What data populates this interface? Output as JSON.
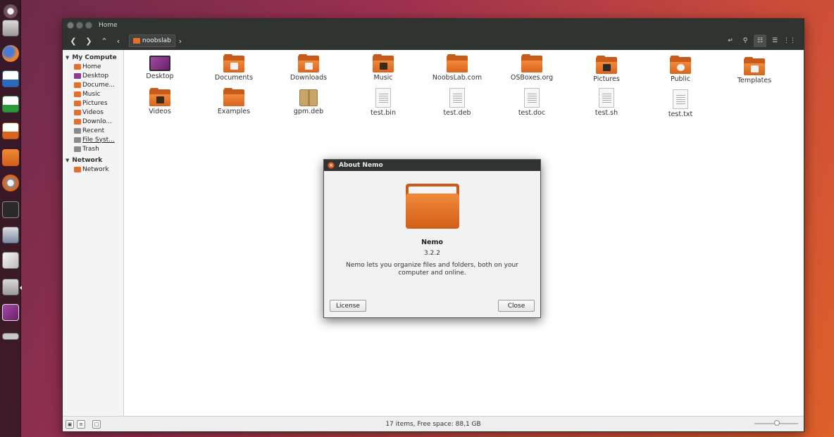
{
  "window": {
    "title": "Home",
    "breadcrumb": "noobslab"
  },
  "sidebar": {
    "sections": [
      {
        "title": "My Compute",
        "items": [
          {
            "label": "Home",
            "icon": "home-folder-icon"
          },
          {
            "label": "Desktop",
            "icon": "desktop-icon"
          },
          {
            "label": "Docume...",
            "icon": "documents-folder-icon"
          },
          {
            "label": "Music",
            "icon": "music-folder-icon"
          },
          {
            "label": "Pictures",
            "icon": "pictures-folder-icon"
          },
          {
            "label": "Videos",
            "icon": "videos-folder-icon"
          },
          {
            "label": "Downlo...",
            "icon": "downloads-folder-icon"
          },
          {
            "label": "Recent",
            "icon": "recent-icon"
          },
          {
            "label": "File Syst...",
            "icon": "drive-icon"
          },
          {
            "label": "Trash",
            "icon": "trash-icon"
          }
        ]
      },
      {
        "title": "Network",
        "items": [
          {
            "label": "Network",
            "icon": "network-icon"
          }
        ]
      }
    ]
  },
  "files": [
    {
      "label": "Desktop",
      "kind": "monitor"
    },
    {
      "label": "Documents",
      "kind": "folder-docs"
    },
    {
      "label": "Downloads",
      "kind": "folder-down"
    },
    {
      "label": "Music",
      "kind": "folder-music"
    },
    {
      "label": "NoobsLab.com",
      "kind": "folder"
    },
    {
      "label": "OSBoxes.org",
      "kind": "folder"
    },
    {
      "label": "Pictures",
      "kind": "folder-pics"
    },
    {
      "label": "Public",
      "kind": "folder-public"
    },
    {
      "label": "Templates",
      "kind": "folder-templates"
    },
    {
      "label": "Videos",
      "kind": "folder-videos"
    },
    {
      "label": "Examples",
      "kind": "folder-link"
    },
    {
      "label": "gpm.deb",
      "kind": "package"
    },
    {
      "label": "test.bin",
      "kind": "doc"
    },
    {
      "label": "test.deb",
      "kind": "doc"
    },
    {
      "label": "test.doc",
      "kind": "doc"
    },
    {
      "label": "test.sh",
      "kind": "doc"
    },
    {
      "label": "test.txt",
      "kind": "doc"
    }
  ],
  "status": {
    "text": "17 items, Free space: 88,1 GB"
  },
  "dialog": {
    "title": "About Nemo",
    "app_name": "Nemo",
    "version": "3.2.2",
    "description": "Nemo lets you organize files and folders, both on your computer and online.",
    "license_label": "License",
    "close_label": "Close"
  },
  "colors": {
    "accent": "#e86f2a",
    "titlebar": "#2f3430"
  }
}
